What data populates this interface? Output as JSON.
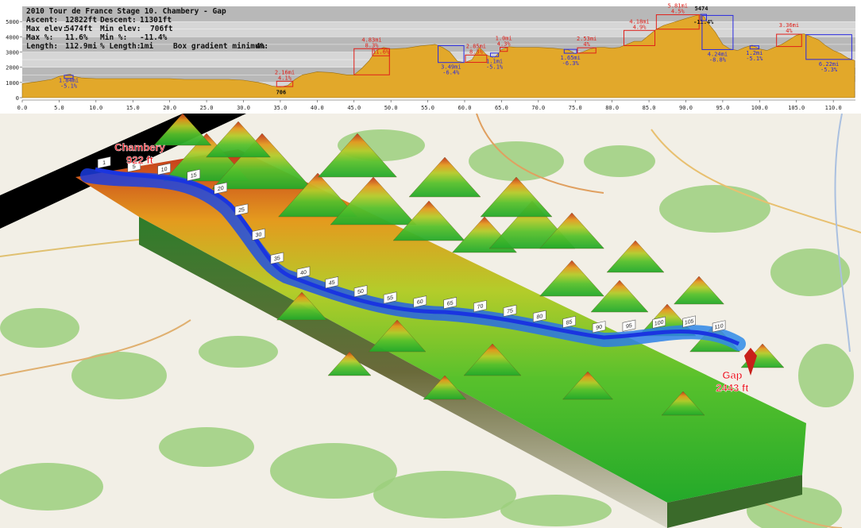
{
  "header": {
    "line1": "2010 Tour de France Stage 10. Chambery - Gap",
    "ascent_label": "Ascent:",
    "ascent_value": "12822ft",
    "descent_label": "Descent:",
    "descent_value": "11301ft",
    "maxelev_label": "Max elev:",
    "maxelev_value": "5474ft",
    "minelev_label": "Min elev:",
    "minelev_value": "706ft",
    "maxpct_label": "Max %:",
    "maxpct_value": "11.6%",
    "minpct_label": "Min %:",
    "minpct_value": "-11.4%",
    "length_label": "Length:",
    "length_value": "112.9mi",
    "pctlen_label": "% Length:",
    "pctlen_value": "1mi",
    "boxgrad_label": "Box gradient minimum:",
    "boxgrad_value": "4%"
  },
  "chart_data": {
    "type": "area",
    "title": "2010 Tour de France Stage 10. Chambery - Gap",
    "xlabel": "",
    "ylabel": "",
    "xlim": [
      0,
      113
    ],
    "ylim": [
      0,
      6000
    ],
    "x_ticks": [
      "0.0",
      "5.0",
      "10.0",
      "15.0",
      "20.0",
      "25.0",
      "30.0",
      "35.0",
      "40.0",
      "45.0",
      "50.0",
      "55.0",
      "60.0",
      "65.0",
      "70.0",
      "75.0",
      "80.0",
      "85.0",
      "90.0",
      "95.0",
      "100.0",
      "105.0",
      "110.0"
    ],
    "y_ticks": [
      "0",
      "1000",
      "2000",
      "3000",
      "4000",
      "5000"
    ],
    "fill_color": "#e2a82a",
    "series": [
      {
        "x": [
          0,
          2,
          4,
          5,
          6,
          6.5,
          7,
          8,
          10,
          12,
          15,
          18,
          20,
          22,
          25,
          28,
          30,
          32,
          33,
          34,
          35,
          36,
          37,
          38,
          40,
          42,
          44,
          45,
          46,
          47,
          48,
          49,
          50,
          52,
          54,
          55,
          56,
          57,
          58,
          59,
          60,
          61,
          62,
          63,
          64,
          65,
          66,
          67,
          68,
          70,
          72,
          73,
          74,
          75,
          76,
          77,
          78,
          79,
          80,
          81,
          82,
          83,
          84,
          85,
          86,
          87,
          88,
          89,
          90,
          91,
          92,
          92.5,
          93,
          94,
          95,
          96,
          97,
          98,
          99,
          100,
          101,
          102,
          103,
          104,
          105,
          106,
          107,
          108,
          109,
          110,
          111,
          112,
          112.9
        ],
        "y": [
          922,
          1050,
          1200,
          1400,
          1500,
          1550,
          1400,
          1300,
          1250,
          1250,
          1250,
          1250,
          1250,
          1200,
          1200,
          1200,
          1150,
          1000,
          900,
          750,
          706,
          800,
          1200,
          1500,
          1700,
          1650,
          1500,
          1500,
          1900,
          2400,
          3100,
          3300,
          3200,
          3250,
          3400,
          3450,
          3500,
          3300,
          3000,
          2400,
          2300,
          2500,
          3300,
          2800,
          2600,
          3150,
          3350,
          3300,
          3300,
          3300,
          3250,
          3200,
          3150,
          2900,
          3000,
          3200,
          3300,
          3300,
          3250,
          3300,
          3500,
          3700,
          3700,
          4100,
          4500,
          4750,
          4900,
          5050,
          5200,
          5350,
          5474,
          5300,
          4900,
          4300,
          3500,
          3200,
          3100,
          3300,
          3450,
          3200,
          3100,
          3300,
          3500,
          3800,
          4100,
          4200,
          4000,
          3800,
          3400,
          3100,
          2900,
          2600,
          2443
        ]
      }
    ],
    "climb_annotations": [
      {
        "text1": "1.84mi",
        "text2": "-5.1%",
        "type": "descent",
        "x_start": 5.7,
        "x_end": 6.9
      },
      {
        "text1": "2.16mi",
        "text2": "4.1%",
        "type": "climb",
        "x_start": 34.5,
        "x_end": 36.7
      },
      {
        "text1": "4.83mi",
        "text2": "8.3%",
        "type": "climb",
        "x_start": 45,
        "x_end": 49.8
      },
      {
        "text1": "",
        "text2": "11.6%",
        "type": "climb-max",
        "x_start": 47.5,
        "x_end": 49.8
      },
      {
        "text1": "3.49mi",
        "text2": "-6.4%",
        "type": "descent",
        "x_start": 56.4,
        "x_end": 59.9
      },
      {
        "text1": "2.85mi",
        "text2": "8.3%",
        "type": "climb",
        "x_start": 60.1,
        "x_end": 63
      },
      {
        "text1": "1.1mi",
        "text2": "-5.1%",
        "type": "descent",
        "x_start": 63.5,
        "x_end": 64.6
      },
      {
        "text1": "1.0mi",
        "text2": "4.3%",
        "type": "climb",
        "x_start": 64.8,
        "x_end": 65.8
      },
      {
        "text1": "1.65mi",
        "text2": "-6.3%",
        "type": "descent",
        "x_start": 73.5,
        "x_end": 75.2
      },
      {
        "text1": "2.53mi",
        "text2": "4%",
        "type": "climb",
        "x_start": 75.3,
        "x_end": 77.8
      },
      {
        "text1": "4.18mi",
        "text2": "4.9%",
        "type": "climb",
        "x_start": 81.6,
        "x_end": 85.8
      },
      {
        "text1": "5.81mi",
        "text2": "4.5%",
        "type": "climb",
        "x_start": 86,
        "x_end": 91.8
      },
      {
        "text1": "",
        "text2": "-11.4%",
        "type": "descent-max",
        "x_start": 92,
        "x_end": 92.8
      },
      {
        "text1": "4.24mi",
        "text2": "-8.8%",
        "type": "descent",
        "x_start": 92.2,
        "x_end": 96.4
      },
      {
        "text1": "1.2mi",
        "text2": "-5.1%",
        "type": "descent",
        "x_start": 98.7,
        "x_end": 99.9
      },
      {
        "text1": "3.36mi",
        "text2": "4%",
        "type": "climb",
        "x_start": 102.3,
        "x_end": 105.7
      },
      {
        "text1": "6.22mi",
        "text2": "-5.3%",
        "type": "descent",
        "x_start": 106.3,
        "x_end": 112.5
      }
    ],
    "point_labels": [
      {
        "text": "706",
        "x": 35,
        "y": 706
      },
      {
        "text": "5474",
        "x": 92,
        "y": 5474
      }
    ]
  },
  "map": {
    "start_label": "Chambery",
    "start_elev": "922 ft",
    "end_label": "Gap",
    "end_elev": "2443 ft",
    "route_color": "#1a35e0",
    "land_color": "#f2efe6",
    "forest_color": "#9ccf7c",
    "marker_labels": [
      "1",
      "5",
      "10",
      "15",
      "20",
      "25",
      "30",
      "35",
      "40",
      "45",
      "50",
      "55",
      "60",
      "65",
      "70",
      "75",
      "80",
      "85",
      "90",
      "95",
      "100",
      "105",
      "110"
    ]
  }
}
